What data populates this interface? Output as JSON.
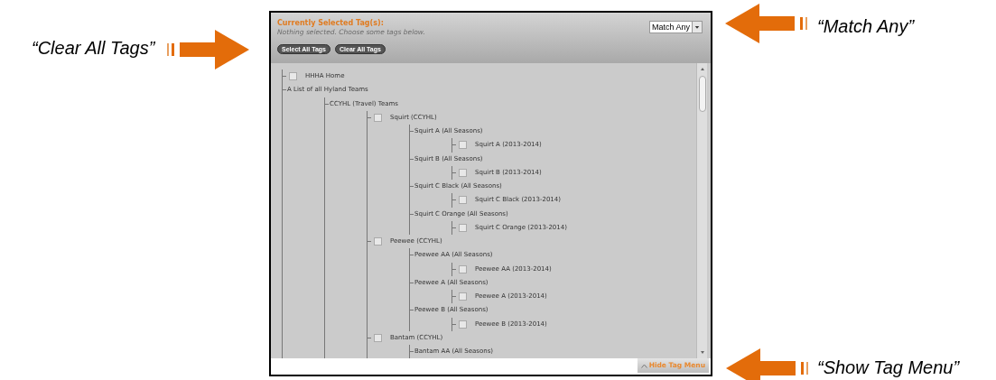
{
  "tag_menu": {
    "title": "Currently Selected Tag(s):",
    "status": "Nothing selected. Choose some tags below.",
    "buttons": [
      "Select All Tags",
      "Clear All Tags"
    ],
    "match_select": {
      "value": "Match Any"
    },
    "tree": [
      {
        "label": "HHHA Home",
        "kind": "checkbox",
        "checked": false
      },
      {
        "label": "A List of all Hyland Teams",
        "kind": "group",
        "children": [
          {
            "label": "CCYHL (Travel) Teams",
            "kind": "group",
            "children": [
              {
                "label": "Squirt (CCYHL)",
                "kind": "checkbox",
                "checked": false,
                "children": [
                  {
                    "label": "Squirt A (All Seasons)",
                    "kind": "group",
                    "children": [
                      {
                        "label": "Squirt A (2013-2014)",
                        "kind": "checkbox",
                        "checked": false
                      }
                    ]
                  },
                  {
                    "label": "Squirt B (All Seasons)",
                    "kind": "group",
                    "children": [
                      {
                        "label": "Squirt B (2013-2014)",
                        "kind": "checkbox",
                        "checked": false
                      }
                    ]
                  },
                  {
                    "label": "Squirt C Black (All Seasons)",
                    "kind": "group",
                    "children": [
                      {
                        "label": "Squirt C Black (2013-2014)",
                        "kind": "checkbox",
                        "checked": false
                      }
                    ]
                  },
                  {
                    "label": "Squirt C Orange (All Seasons)",
                    "kind": "group",
                    "children": [
                      {
                        "label": "Squirt C Orange (2013-2014)",
                        "kind": "checkbox",
                        "checked": false
                      }
                    ]
                  }
                ]
              },
              {
                "label": "Peewee (CCYHL)",
                "kind": "checkbox",
                "checked": false,
                "children": [
                  {
                    "label": "Peewee AA (All Seasons)",
                    "kind": "group",
                    "children": [
                      {
                        "label": "Peewee AA (2013-2014)",
                        "kind": "checkbox",
                        "checked": false
                      }
                    ]
                  },
                  {
                    "label": "Peewee A (All Seasons)",
                    "kind": "group",
                    "children": [
                      {
                        "label": "Peewee A (2013-2014)",
                        "kind": "checkbox",
                        "checked": false
                      }
                    ]
                  },
                  {
                    "label": "Peewee B (All Seasons)",
                    "kind": "group",
                    "children": [
                      {
                        "label": "Peewee B (2013-2014)",
                        "kind": "checkbox",
                        "checked": false
                      }
                    ]
                  }
                ]
              },
              {
                "label": "Bantam (CCYHL)",
                "kind": "checkbox",
                "checked": false,
                "children": [
                  {
                    "label": "Bantam AA (All Seasons)",
                    "kind": "group"
                  }
                ]
              }
            ]
          }
        ]
      }
    ],
    "toggle_button": "Hide Tag Menu"
  },
  "callouts": [
    {
      "text": "“Clear All Tags”",
      "kind": "arrow_right"
    },
    {
      "text": "“Match Any”",
      "kind": "arrow_left"
    },
    {
      "text": "“Show Tag Menu”",
      "kind": "arrow_left"
    }
  ]
}
